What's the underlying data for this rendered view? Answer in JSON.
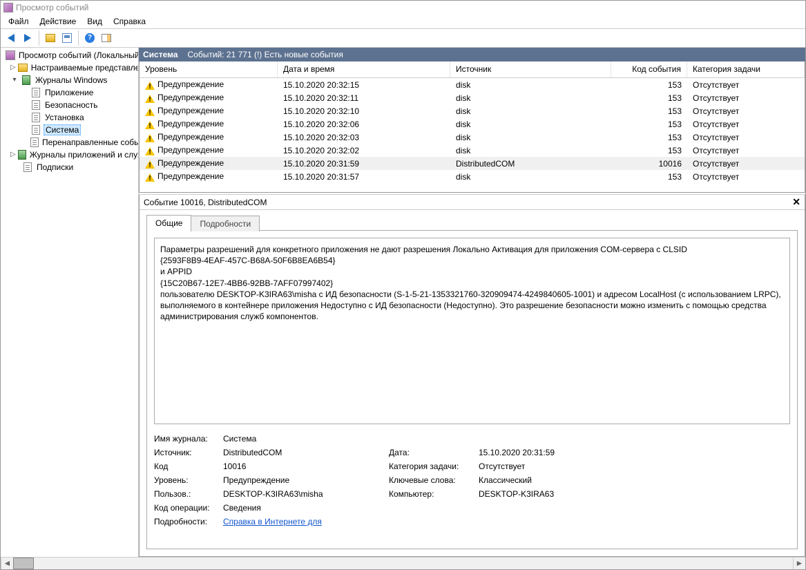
{
  "window": {
    "title": "Просмотр событий"
  },
  "menu": {
    "file": "Файл",
    "action": "Действие",
    "view": "Вид",
    "help": "Справка"
  },
  "tree": {
    "root": "Просмотр событий (Локальный",
    "customViews": "Настраиваемые представления",
    "winLogs": "Журналы Windows",
    "app": "Приложение",
    "security": "Безопасность",
    "setup": "Установка",
    "system": "Система",
    "forwarded": "Перенаправленные события",
    "appsServices": "Журналы приложений и служб",
    "subscriptions": "Подписки"
  },
  "header": {
    "title": "Система",
    "summary": "Событий: 21 771 (!) Есть новые события"
  },
  "columns": {
    "level": "Уровень",
    "date": "Дата и время",
    "source": "Источник",
    "code": "Код события",
    "category": "Категория задачи"
  },
  "rows": [
    {
      "level": "Предупреждение",
      "date": "15.10.2020 20:32:15",
      "source": "disk",
      "code": "153",
      "category": "Отсутствует"
    },
    {
      "level": "Предупреждение",
      "date": "15.10.2020 20:32:11",
      "source": "disk",
      "code": "153",
      "category": "Отсутствует"
    },
    {
      "level": "Предупреждение",
      "date": "15.10.2020 20:32:10",
      "source": "disk",
      "code": "153",
      "category": "Отсутствует"
    },
    {
      "level": "Предупреждение",
      "date": "15.10.2020 20:32:06",
      "source": "disk",
      "code": "153",
      "category": "Отсутствует"
    },
    {
      "level": "Предупреждение",
      "date": "15.10.2020 20:32:03",
      "source": "disk",
      "code": "153",
      "category": "Отсутствует"
    },
    {
      "level": "Предупреждение",
      "date": "15.10.2020 20:32:02",
      "source": "disk",
      "code": "153",
      "category": "Отсутствует"
    },
    {
      "level": "Предупреждение",
      "date": "15.10.2020 20:31:59",
      "source": "DistributedCOM",
      "code": "10016",
      "category": "Отсутствует",
      "selected": true
    },
    {
      "level": "Предупреждение",
      "date": "15.10.2020 20:31:57",
      "source": "disk",
      "code": "153",
      "category": "Отсутствует"
    }
  ],
  "details": {
    "title": "Событие 10016, DistributedCOM",
    "tabs": {
      "general": "Общие",
      "details": "Подробности"
    },
    "description": "Параметры разрешений для конкретного приложения не дают разрешения Локально Активация для приложения COM-сервера с CLSID\n{2593F8B9-4EAF-457C-B68A-50F6B8EA6B54}\n и APPID\n{15C20B67-12E7-4BB6-92BB-7AFF07997402}\n пользователю DESKTOP-K3IRA63\\misha с ИД безопасности (S-1-5-21-1353321760-320909474-4249840605-1001) и адресом LocalHost (с использованием LRPC), выполняемого в контейнере приложения Недоступно с ИД безопасности (Недоступно). Это разрешение безопасности можно изменить с помощью средства администрирования служб компонентов.",
    "labels": {
      "logName": "Имя журнала:",
      "source": "Источник:",
      "code": "Код",
      "level": "Уровень:",
      "user": "Пользов.:",
      "opCode": "Код операции:",
      "more": "Подробности:",
      "date": "Дата:",
      "taskCat": "Категория задачи:",
      "keywords": "Ключевые слова:",
      "computer": "Компьютер:"
    },
    "values": {
      "logName": "Система",
      "source": "DistributedCOM",
      "code": "10016",
      "level": "Предупреждение",
      "user": "DESKTOP-K3IRA63\\misha",
      "opCode": "Сведения",
      "date": "15.10.2020 20:31:59",
      "taskCat": "Отсутствует",
      "keywords": "Классический",
      "computer": "DESKTOP-K3IRA63",
      "moreLink": "Справка в Интернете для "
    }
  }
}
